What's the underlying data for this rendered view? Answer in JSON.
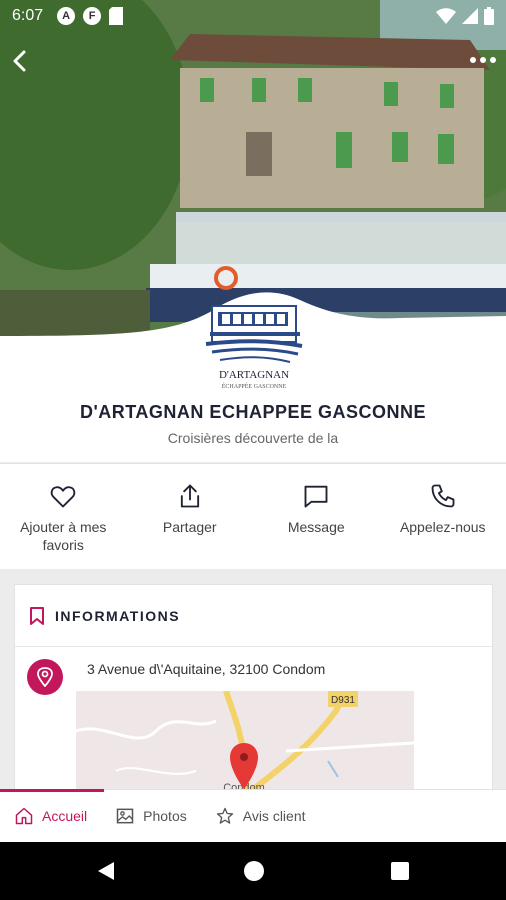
{
  "status_bar": {
    "time": "6:07",
    "icons": [
      "app-a-icon",
      "app-f-icon",
      "sd-card-icon",
      "wifi-icon",
      "signal-icon",
      "battery-icon"
    ]
  },
  "hero": {
    "description_icons": [
      "back-arrow-icon",
      "more-dots-icon"
    ],
    "logo_text": "D'ARTAGNAN",
    "logo_subtext": "ÉCHAPPÉE GASCONNE"
  },
  "business": {
    "title": "D'ARTAGNAN ECHAPPEE GASCONNE",
    "subtitle": "Croisières découverte de la"
  },
  "actions": [
    {
      "label": "Ajouter à mes favoris",
      "icon": "heart-icon"
    },
    {
      "label": "Partager",
      "icon": "share-icon"
    },
    {
      "label": "Message",
      "icon": "message-icon"
    },
    {
      "label": "Appelez-nous",
      "icon": "phone-icon"
    }
  ],
  "info": {
    "title": "INFORMATIONS",
    "address": "3 Avenue d\\'Aquitaine, 32100 Condom",
    "map": {
      "road_label": "D931",
      "town_label": "Condom"
    }
  },
  "tabs": [
    {
      "label": "Accueil",
      "icon": "home-icon",
      "active": true
    },
    {
      "label": "Photos",
      "icon": "image-icon",
      "active": false
    },
    {
      "label": "Avis client",
      "icon": "star-icon",
      "active": false
    }
  ],
  "colors": {
    "accent": "#c2185b",
    "title": "#1e2233"
  }
}
